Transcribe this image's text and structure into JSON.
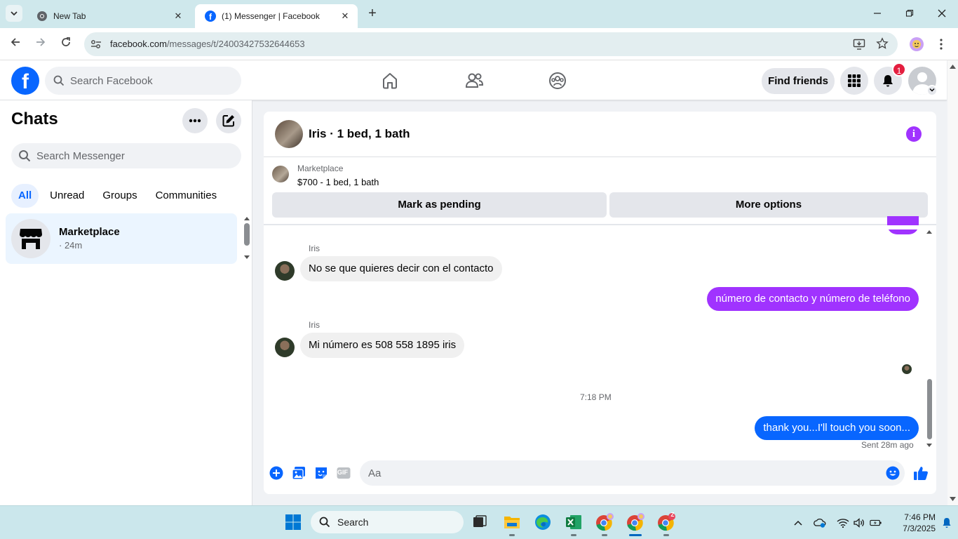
{
  "browser": {
    "tabs": [
      {
        "title": "New Tab",
        "active": false
      },
      {
        "title": "(1) Messenger | Facebook",
        "active": true
      }
    ],
    "new_tab_symbol": "+",
    "close_symbol": "✕",
    "url_host": "facebook.com",
    "url_path": "/messages/t/24003427532644653"
  },
  "facebook": {
    "logo_letter": "f",
    "search_placeholder": "Search Facebook",
    "find_friends": "Find friends",
    "notification_count": "1",
    "brand_color": "#0866ff"
  },
  "chats": {
    "title": "Chats",
    "search_placeholder": "Search Messenger",
    "filters": [
      "All",
      "Unread",
      "Groups",
      "Communities"
    ],
    "items": [
      {
        "name": "Marketplace",
        "time": "· 24m"
      }
    ]
  },
  "conversation": {
    "title": "Iris · 1 bed, 1 bath",
    "marketplace_label": "Marketplace",
    "listing": "$700 - 1 bed, 1 bath",
    "mark_pending": "Mark as pending",
    "more_options": "More options",
    "info_symbol": "i",
    "messages": [
      {
        "sender": "Iris",
        "text": "No se que quieres  decir  con el contacto"
      },
      {
        "sender": "me",
        "text": "número de contacto y número de teléfono"
      },
      {
        "sender": "Iris",
        "text": "Mi número  es 508 558 1895  iris"
      },
      {
        "sender": "me",
        "text": "thank you...I'll touch you soon..."
      }
    ],
    "timestamp": "7:18 PM",
    "sent_status": "Sent 28m ago",
    "composer_placeholder": "Aa",
    "gif_label": "GIF",
    "outgoing_purple": "#a033ff",
    "outgoing_blue": "#0866ff"
  },
  "taskbar": {
    "search_label": "Search",
    "time": "7:46 PM",
    "date": "7/3/2025",
    "chrome_badge": "Z"
  }
}
